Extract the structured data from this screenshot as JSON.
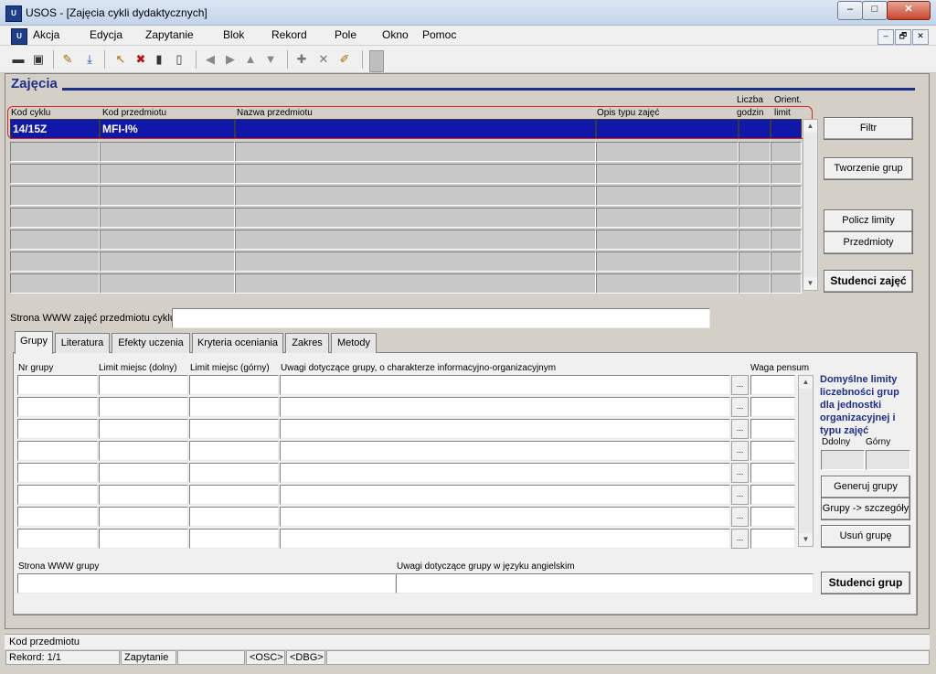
{
  "window": {
    "title": "USOS - [Zajęcia cykli dydaktycznych]",
    "app_icon": "usos-icon",
    "minimize": "–",
    "maximize": "□",
    "close": "✕"
  },
  "menu": {
    "items": [
      "Akcja",
      "Edycja",
      "Zapytanie",
      "Blok",
      "Rekord",
      "Pole",
      "Okno",
      "Pomoc"
    ],
    "mdi": {
      "minimize": "–",
      "restore": "🗗",
      "close": "✕"
    }
  },
  "toolbar": {
    "icons": [
      "save-icon",
      "print-icon",
      "edit-icon",
      "download-icon",
      "query-icon",
      "cancel-query-icon",
      "chart-icon",
      "chart2-icon",
      "prev-icon",
      "next-icon",
      "up-icon",
      "down-icon",
      "insert-icon",
      "delete-icon",
      "clear-icon",
      "exit-icon"
    ]
  },
  "main": {
    "title": "Zajęcia",
    "columns": {
      "kod_cyklu": "Kod cyklu",
      "kod_przedmiotu": "Kod przedmiotu",
      "nazwa_przedmiotu": "Nazwa przedmiotu",
      "opis_typu": "Opis typu zajęć",
      "liczba_godzin_1": "Liczba",
      "liczba_godzin_2": "godzin",
      "orient_limit_1": "Orient.",
      "orient_limit_2": "limit"
    },
    "first_row": {
      "kod_cyklu": "14/15Z",
      "kod_przedmiotu": "MFI-I%",
      "nazwa": "",
      "opis": "",
      "godzin": "",
      "limit": ""
    },
    "buttons": {
      "filtr": "Filtr",
      "tworzenie_grup": "Tworzenie grup",
      "policz_limity": "Policz limity",
      "przedmioty": "Przedmioty",
      "studenci_zajec": "Studenci zajęć"
    },
    "www_label": "Strona WWW zajęć przedmiotu cyklu",
    "www_value": ""
  },
  "tabs": [
    "Grupy",
    "Literatura",
    "Efekty uczenia",
    "Kryteria oceniania",
    "Zakres",
    "Metody"
  ],
  "groups": {
    "columns": {
      "nr": "Nr grupy",
      "limit_dolny": "Limit miejsc (dolny)",
      "limit_gorny": "Limit miejsc (górny)",
      "uwagi": "Uwagi dotyczące grupy, o charakterze informacyjno-organizacyjnym",
      "waga": "Waga pensum"
    },
    "dots": "...",
    "defaults_title": "Domyślne limity liczebności grup dla jednostki organizacyjnej i typu zajęć",
    "defaults_dolny": "Ddolny",
    "defaults_gorny": "Górny",
    "buttons": {
      "generuj": "Generuj grupy",
      "szczegoly": "Grupy -> szczegóły",
      "usun": "Usuń grupę",
      "studenci_grup": "Studenci grup"
    },
    "www_grupy_label": "Strona WWW grupy",
    "uwagi_en_label": "Uwagi dotyczące grupy w języku angielskim"
  },
  "status": {
    "field": "Kod przedmiotu",
    "rekord": "Rekord: 1/1",
    "mode": "Zapytanie",
    "osc": "<OSC>",
    "dbg": "<DBG>"
  }
}
